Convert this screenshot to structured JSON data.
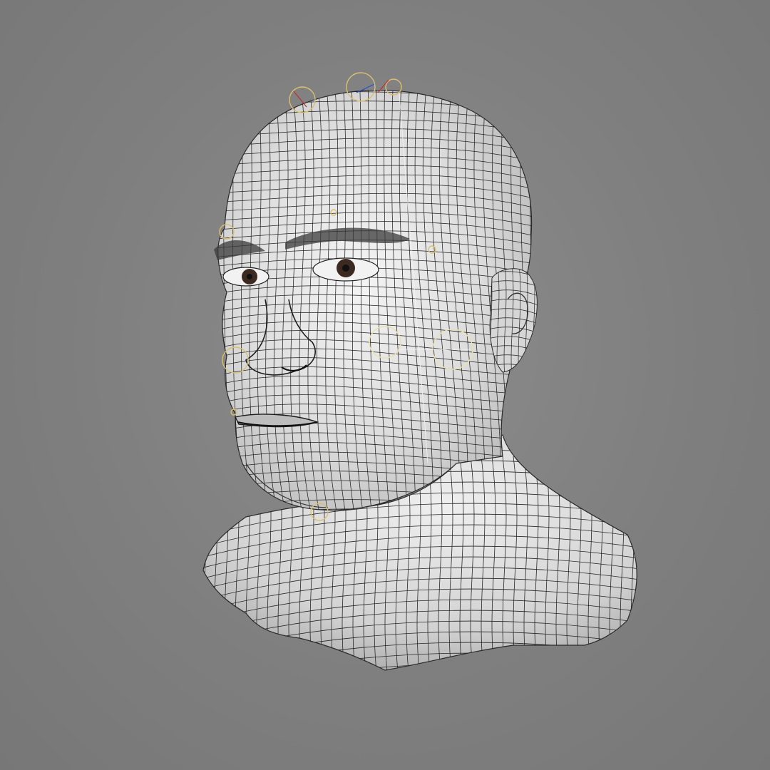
{
  "viewport": {
    "background_color": "#808080",
    "mesh_fill_color": "#dcdcdc",
    "wire_color": "#1f1f1f",
    "rig_controller_color": "#d8c070",
    "rig_axis_colors": [
      "#c03030",
      "#3050c0",
      "#ffffff"
    ]
  },
  "model": {
    "subject": "head-and-bust",
    "display_mode": "wireframe-on-shaded",
    "rig_controls_visible": true
  }
}
